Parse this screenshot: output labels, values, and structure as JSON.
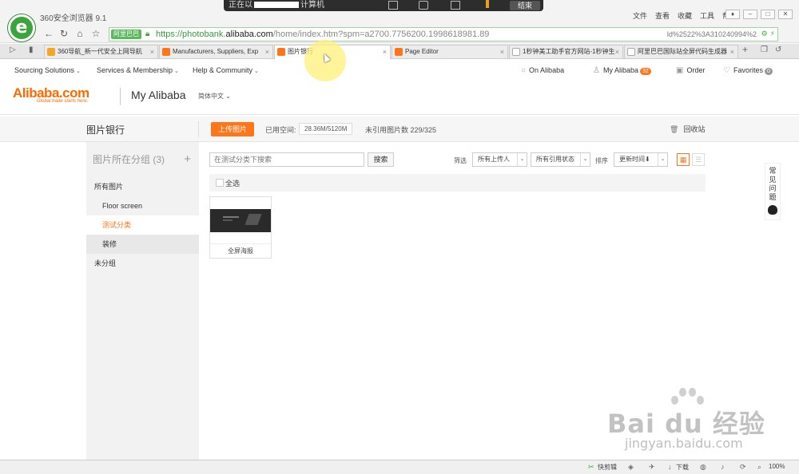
{
  "browser": {
    "name": "360安全浏览器 9.1",
    "logo_letter": "e",
    "recording": {
      "text_prefix": "正在以",
      "text_suffix": "计算机",
      "end_label": "结束"
    },
    "menu": [
      "文件",
      "查看",
      "收藏",
      "工具",
      "帮助"
    ],
    "url": {
      "site_badge": "阿里巴巴",
      "scheme": "https://photobank.",
      "host": "alibaba.com",
      "path": "/home/index.htm",
      "query": "?spm=a2700.7756200.1998618981.89",
      "tail": "ld%2522%3A310240994%2"
    },
    "tabs": [
      {
        "label": "360导航_新一代安全上网导航",
        "active": false,
        "icon_color": "#f5a623"
      },
      {
        "label": "Manufacturers, Suppliers, Exp",
        "active": false,
        "icon_color": "#ff7519"
      },
      {
        "label": "图片银行",
        "active": true,
        "icon_color": "#ff7519"
      },
      {
        "label": "Page Editor",
        "active": false,
        "icon_color": "#ff7519"
      },
      {
        "label": "1秒钟美工助手官方网站-1秒钟生",
        "active": false,
        "icon_color": "#cccccc"
      },
      {
        "label": "阿里巴巴国际站全屏代码生成器",
        "active": false,
        "icon_color": "#cccccc"
      }
    ]
  },
  "alibaba": {
    "top_nav": [
      "Sourcing Solutions",
      "Services & Membership",
      "Help & Community"
    ],
    "on_alibaba": "On Alibaba",
    "my_alibaba": "My Alibaba",
    "my_alibaba_count": "32",
    "order": "Order",
    "favorites": "Favorites",
    "favorites_count": "0",
    "logo_word": "Alibaba.com",
    "logo_sub": "Global trade starts here.",
    "my_alibaba_title": "My Alibaba",
    "language": "简体中文"
  },
  "page": {
    "title": "图片银行",
    "upload_label": "上传图片",
    "space_label": "已用空间:",
    "space_value": "28.36M/5120M",
    "unreferenced": "未引用图片数 229/325",
    "recycle": "回收站"
  },
  "sidebar": {
    "header": "图片所在分组 (3)",
    "add": "+",
    "items": [
      {
        "label": "所有图片"
      },
      {
        "label": "Floor screen"
      },
      {
        "label": "测试分类"
      },
      {
        "label": "装修"
      },
      {
        "label": "未分组"
      }
    ]
  },
  "toolbar": {
    "search_placeholder": "在测试分类下搜索",
    "search_button": "搜索",
    "filter_label": "筛选",
    "uploader": "所有上传人",
    "reference": "所有引用状态",
    "sort_label": "排序",
    "sort_value": "更新时间⬇"
  },
  "selection": {
    "select_all": "全选"
  },
  "images": [
    {
      "name": "全屏海报"
    }
  ],
  "help_tab": {
    "chars": [
      "常",
      "见",
      "问",
      "题"
    ]
  },
  "statusbar": {
    "accelerator": "快剪辑",
    "download": "下载",
    "zoom": "100%"
  },
  "watermark": {
    "brand": "Bai du 经验",
    "url": "jingyan.baidu.com"
  }
}
